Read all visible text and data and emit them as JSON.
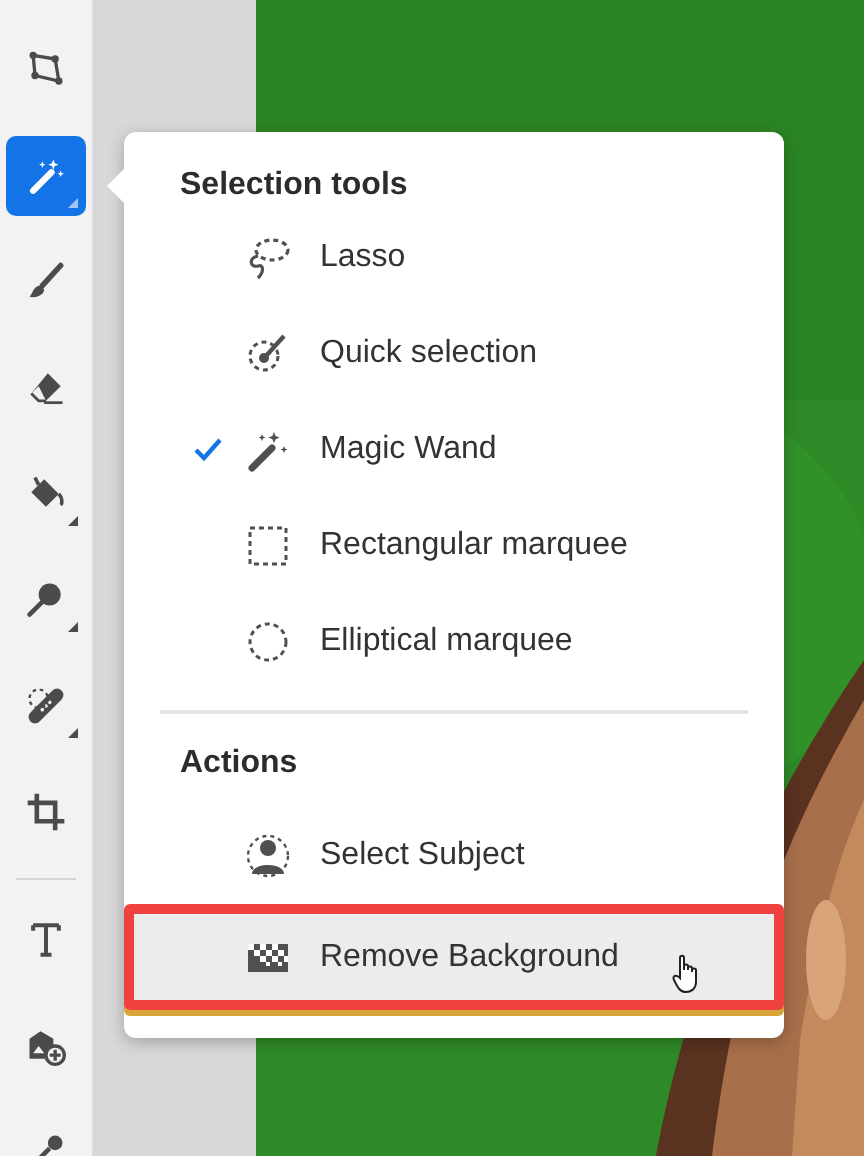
{
  "toolbar": {
    "tools": [
      {
        "selected": false,
        "submenu": false
      },
      {
        "selected": true,
        "submenu": true
      },
      {
        "selected": false,
        "submenu": false
      },
      {
        "selected": false,
        "submenu": false
      },
      {
        "selected": false,
        "submenu": true
      },
      {
        "selected": false,
        "submenu": true
      },
      {
        "selected": false,
        "submenu": true
      },
      {
        "selected": false,
        "submenu": false
      },
      {
        "selected": false,
        "submenu": false
      },
      {
        "selected": false,
        "submenu": false
      },
      {
        "selected": false
      }
    ]
  },
  "menu": {
    "sections": [
      {
        "title": "Selection tools",
        "items": [
          {
            "label": "Lasso",
            "checked": false,
            "hovered": false,
            "annotated": false
          },
          {
            "label": "Quick selection",
            "checked": false,
            "hovered": false,
            "annotated": false
          },
          {
            "label": "Magic Wand",
            "checked": true,
            "hovered": false,
            "annotated": false
          },
          {
            "label": "Rectangular marquee",
            "checked": false,
            "hovered": false,
            "annotated": false
          },
          {
            "label": "Elliptical marquee",
            "checked": false,
            "hovered": false,
            "annotated": false
          }
        ]
      },
      {
        "title": "Actions",
        "items": [
          {
            "label": "Select Subject",
            "checked": false,
            "hovered": false,
            "annotated": false
          },
          {
            "label": "Remove Background",
            "checked": false,
            "hovered": true,
            "annotated": true
          }
        ]
      }
    ]
  }
}
